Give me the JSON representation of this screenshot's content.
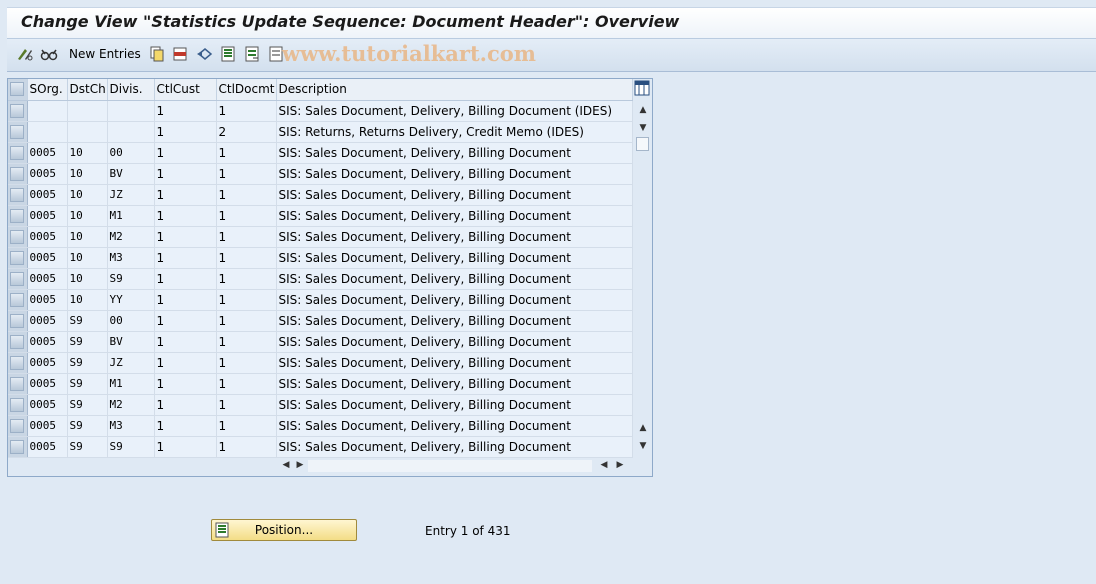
{
  "window": {
    "title": "Change View \"Statistics Update Sequence: Document Header\": Overview"
  },
  "toolbar": {
    "new_entries_label": "New Entries",
    "watermark": "www.tutorialkart.com",
    "icons": [
      "display-change-icon",
      "copy-as-icon",
      "delete-icon",
      "undo-icon",
      "select-all-icon",
      "select-block-icon",
      "deselect-all-icon"
    ]
  },
  "table": {
    "columns": [
      "SOrg.",
      "DstCh",
      "Divis.",
      "CtlCust",
      "CtlDocmt",
      "Description"
    ],
    "rows": [
      [
        "",
        "",
        "",
        "1",
        "1",
        "SIS: Sales Document, Delivery, Billing Document (IDES)"
      ],
      [
        "",
        "",
        "",
        "1",
        "2",
        "SIS: Returns, Returns Delivery, Credit Memo (IDES)"
      ],
      [
        "0005",
        "10",
        "00",
        "1",
        "1",
        "SIS: Sales Document, Delivery, Billing Document"
      ],
      [
        "0005",
        "10",
        "BV",
        "1",
        "1",
        "SIS: Sales Document, Delivery, Billing Document"
      ],
      [
        "0005",
        "10",
        "JZ",
        "1",
        "1",
        "SIS: Sales Document, Delivery, Billing Document"
      ],
      [
        "0005",
        "10",
        "M1",
        "1",
        "1",
        "SIS: Sales Document, Delivery, Billing Document"
      ],
      [
        "0005",
        "10",
        "M2",
        "1",
        "1",
        "SIS: Sales Document, Delivery, Billing Document"
      ],
      [
        "0005",
        "10",
        "M3",
        "1",
        "1",
        "SIS: Sales Document, Delivery, Billing Document"
      ],
      [
        "0005",
        "10",
        "S9",
        "1",
        "1",
        "SIS: Sales Document, Delivery, Billing Document"
      ],
      [
        "0005",
        "10",
        "YY",
        "1",
        "1",
        "SIS: Sales Document, Delivery, Billing Document"
      ],
      [
        "0005",
        "S9",
        "00",
        "1",
        "1",
        "SIS: Sales Document, Delivery, Billing Document"
      ],
      [
        "0005",
        "S9",
        "BV",
        "1",
        "1",
        "SIS: Sales Document, Delivery, Billing Document"
      ],
      [
        "0005",
        "S9",
        "JZ",
        "1",
        "1",
        "SIS: Sales Document, Delivery, Billing Document"
      ],
      [
        "0005",
        "S9",
        "M1",
        "1",
        "1",
        "SIS: Sales Document, Delivery, Billing Document"
      ],
      [
        "0005",
        "S9",
        "M2",
        "1",
        "1",
        "SIS: Sales Document, Delivery, Billing Document"
      ],
      [
        "0005",
        "S9",
        "M3",
        "1",
        "1",
        "SIS: Sales Document, Delivery, Billing Document"
      ],
      [
        "0005",
        "S9",
        "S9",
        "1",
        "1",
        "SIS: Sales Document, Delivery, Billing Document"
      ]
    ]
  },
  "footer": {
    "position_button_label": "Position...",
    "entry_text": "Entry 1 of 431"
  }
}
